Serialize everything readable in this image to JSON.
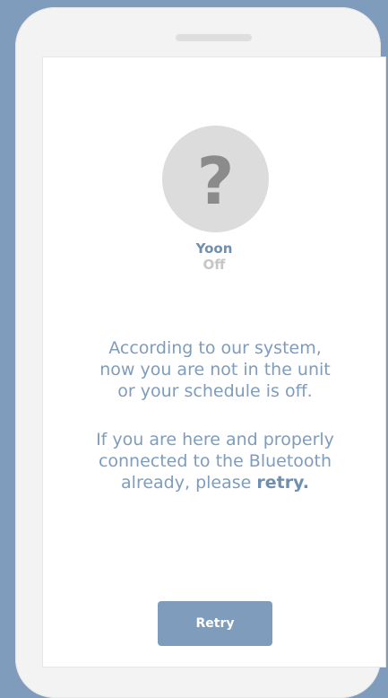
{
  "user": {
    "avatar_icon": "question-mark-icon",
    "avatar_glyph": "?",
    "name": "Yoon",
    "status": "Off"
  },
  "message": {
    "paragraph1": {
      "line1": "According to our system,",
      "line2": "now you are not in the unit",
      "line3": "or your schedule is off."
    },
    "paragraph2": {
      "line1": "If you are here and properly",
      "line2": "connected to the Bluetooth",
      "line3_prefix": "already, please ",
      "line3_bold": "retry."
    }
  },
  "actions": {
    "retry_label": "Retry"
  },
  "colors": {
    "background": "#7f9cbc",
    "accent": "#7f9cbc",
    "name_text": "#6f8fb0",
    "status_text": "#c6c6c6",
    "avatar_bg": "#dcdcdc"
  }
}
